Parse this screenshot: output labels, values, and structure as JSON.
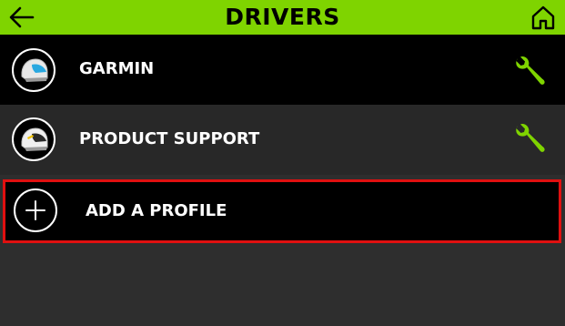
{
  "header": {
    "title": "DRIVERS",
    "back_icon": "arrow-left-icon",
    "home_icon": "home-icon",
    "background_color": "#7fd400"
  },
  "drivers": [
    {
      "name": "GARMIN",
      "avatar_icon": "helmet-blue-icon",
      "action_icon": "wrench-icon"
    },
    {
      "name": "PRODUCT SUPPORT",
      "avatar_icon": "helmet-yellow-icon",
      "action_icon": "wrench-icon"
    }
  ],
  "add_profile": {
    "label": "ADD A PROFILE",
    "icon": "plus-icon",
    "highlight_color": "#e01010"
  },
  "accent_color": "#7fd400"
}
